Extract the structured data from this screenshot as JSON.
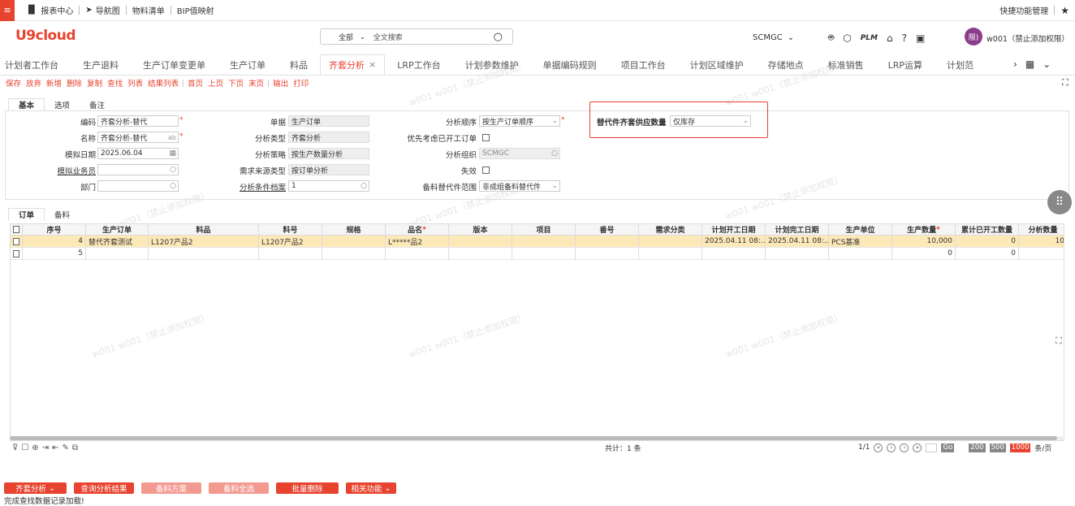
{
  "topbar": {
    "items": [
      "报表中心",
      "导航图",
      "物料清单",
      "BIP值映射"
    ],
    "right_label": "快捷功能管理"
  },
  "header": {
    "logo": "U9cloud",
    "search_scope": "全部",
    "search_placeholder": "全文搜索",
    "org": "SCMGC",
    "user_avatar": "限)",
    "user_name": "w001（禁止添加权限）",
    "plm": "PLM"
  },
  "tabs": [
    "计划者工作台",
    "生产退料",
    "生产订单变更单",
    "生产订单",
    "料品",
    "齐套分析",
    "LRP工作台",
    "计划参数维护",
    "单据编码规则",
    "项目工作台",
    "计划区域维护",
    "存储地点",
    "标准销售",
    "LRP运算",
    "计划范"
  ],
  "toolbar": [
    "保存",
    "放弃",
    "新增",
    "删除",
    "复制",
    "查找",
    "列表",
    "结果列表",
    "首页",
    "上页",
    "下页",
    "末页",
    "输出",
    "打印"
  ],
  "form_tabs": [
    "基本",
    "选项",
    "备注"
  ],
  "form": {
    "code_label": "编码",
    "code_value": "齐套分析-替代",
    "name_label": "名称",
    "name_value": "齐套分析-替代",
    "name_suffix": "ab",
    "date_label": "模拟日期",
    "date_value": "2025.06.04",
    "salesman_label": "模拟业务员",
    "dept_label": "部门",
    "doc_label": "单据",
    "doc_value": "生产订单",
    "type_label": "分析类型",
    "type_value": "齐套分析",
    "strategy_label": "分析策略",
    "strategy_value": "按生产数量分析",
    "demand_label": "需求来源类型",
    "demand_value": "按订单分析",
    "plan_label": "分析条件档案",
    "plan_value": "1",
    "order_label": "分析顺序",
    "order_value": "按生产订单顺序",
    "priority_label": "优先考虑已开工订单",
    "org_label": "分析组织",
    "org_value": "SCMGC",
    "invalid_label": "失效",
    "range_label": "备料替代件范围",
    "range_value": "非成组备料替代件",
    "sub_label": "替代件齐套供应数量",
    "sub_value": "仅库存"
  },
  "grid_tabs": [
    "订单",
    "备料"
  ],
  "grid": {
    "columns": [
      "序号",
      "生产订单",
      "料品",
      "料号",
      "规格",
      "品名",
      "版本",
      "项目",
      "番号",
      "需求分类",
      "计划开工日期",
      "计划完工日期",
      "生产单位",
      "生产数量",
      "累计已开工数量",
      "分析数量"
    ],
    "rows": [
      [
        "4",
        "替代齐套测试",
        "L1207产品2",
        "L1207产品2",
        "",
        "L*****品2",
        "",
        "",
        "",
        "",
        "2025.04.11 08:...",
        "2025.04.11 08:...",
        "PCS基准",
        "10,000",
        "0",
        "10"
      ],
      [
        "5",
        "",
        "",
        "",
        "",
        "",
        "",
        "",
        "",
        "",
        "",
        "",
        "",
        "0",
        "0",
        ""
      ]
    ]
  },
  "pager": {
    "total": "共计：1 条",
    "page": "1/1",
    "go": "Go",
    "sizes": [
      "200",
      "500",
      "1000"
    ],
    "unit": "条/页"
  },
  "actions": [
    "齐套分析",
    "查询分析结果",
    "备料方案",
    "备料全选",
    "批量删除",
    "相关功能"
  ],
  "status": "完成查找数据记录加载!",
  "watermark": "w001 w001（禁止添加权限）",
  "colors": {
    "accent": "#e8432f",
    "row_highlight": "#fde8b8",
    "alert_border": "#e8432f"
  }
}
